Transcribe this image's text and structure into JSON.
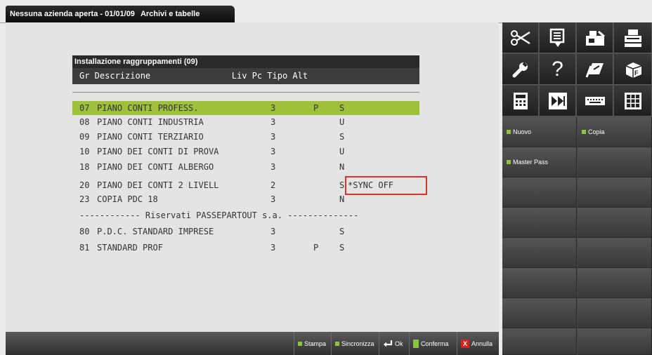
{
  "title_tab": {
    "company": "Nessuna azienda aperta - 01/01/09",
    "section": "Archivi e tabelle"
  },
  "panel": {
    "title": "Installazione raggruppamenti (09)",
    "columns_header": "Gr Descrizione                Liv Pc Tipo Alt"
  },
  "rows": [
    {
      "gr": "07",
      "desc": "PIANO CONTI PROFESS.",
      "liv": "3",
      "pc": "P",
      "alt": "S",
      "note": ""
    },
    {
      "gr": "08",
      "desc": "PIANO CONTI INDUSTRIA",
      "liv": "3",
      "pc": "",
      "alt": "U",
      "note": ""
    },
    {
      "gr": "09",
      "desc": "PIANO CONTI TERZIARIO",
      "liv": "3",
      "pc": "",
      "alt": "S",
      "note": ""
    },
    {
      "gr": "10",
      "desc": "PIANO DEI CONTI DI PROVA",
      "liv": "3",
      "pc": "",
      "alt": "U",
      "note": ""
    },
    {
      "gr": "18",
      "desc": "PIANO DEI CONTI ALBERGO",
      "liv": "3",
      "pc": "",
      "alt": "N",
      "note": ""
    },
    {
      "gr": "20",
      "desc": "PIANO DEI CONTI 2 LIVELL",
      "liv": "2",
      "pc": "",
      "alt": "S",
      "note": "*SYNC OFF"
    },
    {
      "gr": "23",
      "desc": "COPIA PDC 18",
      "liv": "3",
      "pc": "",
      "alt": "N",
      "note": ""
    },
    {
      "gr": "80",
      "desc": "P.D.C. STANDARD IMPRESE",
      "liv": "3",
      "pc": "",
      "alt": "S",
      "note": ""
    },
    {
      "gr": "81",
      "desc": "STANDARD PROF",
      "liv": "3",
      "pc": "P",
      "alt": "S",
      "note": ""
    }
  ],
  "reserved_separator": "------------ Riservati PASSEPARTOUT s.a. --------------",
  "bottom_buttons": {
    "stampa": "Stampa",
    "sincronizza": "Sincronizza",
    "ok": "Ok",
    "conferma": "Conferma",
    "annulla": "Annulla"
  },
  "sidebar_icons": [
    "scissors-icon",
    "document-pin-icon",
    "fax-icon",
    "printer-icon",
    "wrench-icon",
    "help-icon",
    "notebook-icon",
    "box-f-icon",
    "calculator-icon",
    "fast-forward-icon",
    "keyboard-icon",
    "grid-icon"
  ],
  "sidebar_buttons": {
    "nuovo": "Nuovo",
    "copia": "Copia",
    "master_pass": "Master Pass"
  },
  "colors": {
    "selected_row": "#9fc03a",
    "accent_green": "#8cc63f",
    "highlight_box": "#e0302c",
    "annulla_red": "#d8221e"
  }
}
